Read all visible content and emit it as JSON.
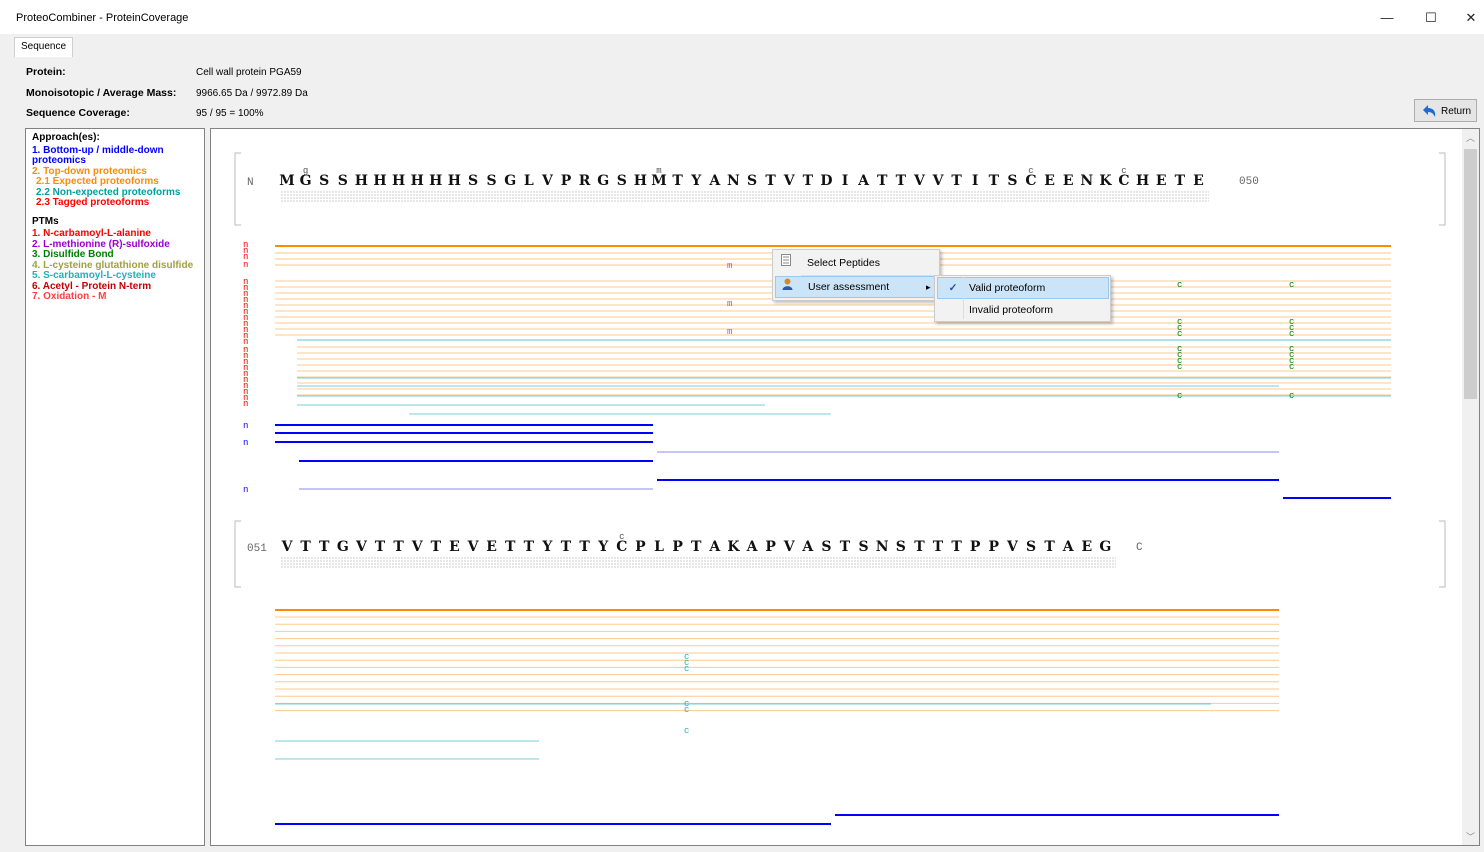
{
  "window": {
    "title": "ProteoCombiner - ProteinCoverage",
    "minimize": "—",
    "maximize": "☐",
    "close": "✕"
  },
  "tabs": [
    {
      "label": "Sequence"
    }
  ],
  "info": {
    "protein_label": "Protein:",
    "protein_value": "Cell wall protein PGA59",
    "mass_label": "Monoisotopic / Average Mass:",
    "mass_value": "9966.65 Da / 9972.89 Da",
    "coverage_label": "Sequence Coverage:",
    "coverage_value": "95 / 95 = 100%"
  },
  "return_button": {
    "label": "Return",
    "icon": "undo-arrow-icon"
  },
  "legend": {
    "approach_header": "Approach(es):",
    "approaches": [
      {
        "text": "1. Bottom-up / middle-down proteomics",
        "color": "#0000ff"
      },
      {
        "text": "2. Top-down proteomics",
        "color": "#ff8c00"
      },
      {
        "text": "2.1 Expected proteoforms",
        "color": "#ff8c00"
      },
      {
        "text": "2.2 Non-expected proteoforms",
        "color": "#00a0a0"
      },
      {
        "text": "2.3 Tagged proteoforms",
        "color": "#ff0000"
      }
    ],
    "ptm_header": "PTMs",
    "ptms": [
      {
        "text": "1. N-carbamoyl-L-alanine",
        "color": "#ff0000"
      },
      {
        "text": "2. L-methionine (R)-sulfoxide",
        "color": "#9900cc"
      },
      {
        "text": "3. Disulfide Bond",
        "color": "#008000"
      },
      {
        "text": "4. L-cysteine glutathione disulfide",
        "color": "#a0a040"
      },
      {
        "text": "5. S-carbamoyl-L-cysteine",
        "color": "#20b0c0"
      },
      {
        "text": "6. Acetyl - Protein N-term",
        "color": "#c00000"
      },
      {
        "text": "7. Oxidation - M",
        "color": "#ff4040"
      }
    ]
  },
  "sequence": {
    "block1": {
      "start_label": "N",
      "residues": "MGSSHHHHHHSSGLVPRGSHMTYANSTVTDIATTVVTITSCEENKCHETE",
      "end_label": "050",
      "marks": [
        {
          "pos": 2,
          "mark": "g"
        },
        {
          "pos": 21,
          "mark": "m"
        },
        {
          "pos": 41,
          "mark": "c"
        },
        {
          "pos": 46,
          "mark": "c"
        }
      ]
    },
    "block2": {
      "start_label": "051",
      "residues": "VTTGVTTVTEVETTYTTYCPLPTAKAPVASTSNSTTTPPVSTAEG",
      "end_label": "C",
      "marks": [
        {
          "pos": 19,
          "mark": "c"
        }
      ]
    }
  },
  "context_menu": {
    "items": [
      {
        "label": "Select Peptides",
        "icon": "list-icon"
      },
      {
        "label": "User assessment",
        "icon": "user-icon",
        "submenu_arrow": "▸"
      }
    ],
    "submenu": [
      {
        "label": "Valid proteoform",
        "checked": true,
        "check": "✓"
      },
      {
        "label": "Invalid proteoform",
        "checked": false
      }
    ]
  },
  "colors": {
    "bottom_up": "#0000ff",
    "top_down": "#ff8c00",
    "non_expected": "#20b0c0",
    "tagged": "#ff0000",
    "disulfide": "#008000"
  }
}
